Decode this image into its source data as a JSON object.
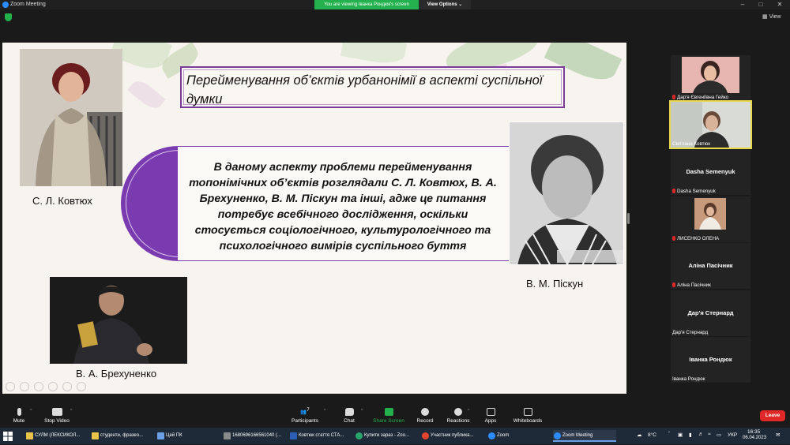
{
  "window": {
    "title": "Zoom Meeting"
  },
  "share_banner": {
    "text": "You are viewing Іванка Рондюк's screen",
    "view_options": "View Options"
  },
  "top_right": {
    "view_label": "View"
  },
  "slide": {
    "title": "Перейменування об’єктів урбанонімії в аспекті суспільної думки",
    "main_text": "В даному аспекту проблеми перейменування топонімічних об’єктів розглядали С. Л. Ковтюх, В. А. Брехуненко, В. М. Піскун та інші, адже це питання потребує всебічного дослідження, оскільки стосується соціологічного, культурологічного та психологічного вимірів суспільного буття",
    "captions": {
      "kovtyuk": "С. Л. Ковтюх",
      "piskun": "В. М. Піскун",
      "brekhunenko": "В. А. Брехуненко"
    }
  },
  "participants": [
    {
      "name": "",
      "label": "Дар'я Євгеніївна Гейко",
      "muted": true,
      "video": true
    },
    {
      "name": "",
      "label": "Світлана Ковтюх",
      "muted": false,
      "video": true,
      "active": true
    },
    {
      "name": "Dasha Semenyuk",
      "label": "Dasha Semenyuk",
      "muted": true,
      "video": false
    },
    {
      "name": "",
      "label": "ЛИСЕНКО ОЛЕНА",
      "muted": true,
      "video": true
    },
    {
      "name": "Аліна Пасічник",
      "label": "Аліна Пасічник",
      "muted": true,
      "video": false
    },
    {
      "name": "Дар'я Стернард",
      "label": "Дар'я Стернард",
      "muted": false,
      "video": false
    },
    {
      "name": "Іванка Рондюк",
      "label": "Іванка Рондюк",
      "muted": false,
      "video": false
    }
  ],
  "toolbar": {
    "mute": "Mute",
    "stop_video": "Stop Video",
    "participants": "Participants",
    "participants_count": "7",
    "chat": "Chat",
    "share_screen": "Share Screen",
    "record": "Record",
    "reactions": "Reactions",
    "apps": "Apps",
    "whiteboards": "Whiteboards",
    "leave": "Leave"
  },
  "taskbar": {
    "items": [
      "СУЛМ (ЛЕКСИКОЛ...",
      "студенти, фразео...",
      "Цей ПК",
      "1680696166561040 (...",
      "Ковтюк стаття СТА...",
      "Купити зараз - Zoo...",
      "Участник публика...",
      "Zoom",
      "Zoom Meeting"
    ],
    "weather": "8°C",
    "lang": "УКР",
    "time": "16:35",
    "date": "06.04.2023"
  },
  "colors": {
    "accent_purple": "#7b3bb0",
    "share_green": "#22b14c",
    "leave_red": "#e02828"
  }
}
